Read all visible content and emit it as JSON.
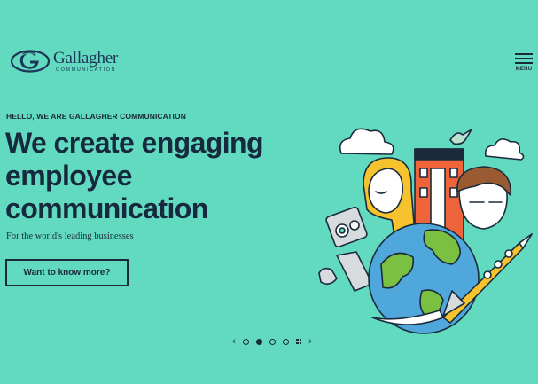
{
  "header": {
    "logo_name": "Gallagher",
    "logo_sub": "COMMUNICATION",
    "menu_label": "MENU"
  },
  "hero": {
    "eyebrow": "HELLO, WE ARE GALLAGHER COMMUNICATION",
    "headline": [
      "We create engaging",
      "employee",
      "communication"
    ],
    "subtitle": "For the world's leading businesses",
    "cta_label": "Want to know more?"
  },
  "pager": {
    "prev": "‹",
    "next": "›",
    "slides": 4,
    "active_index": 1
  },
  "colors": {
    "background": "#62dac0",
    "text": "#1b2a3a",
    "logo_blue": "#1d3556"
  },
  "icons": [
    "gallagher-logo-icon",
    "hamburger-menu-icon",
    "grid-view-icon"
  ]
}
